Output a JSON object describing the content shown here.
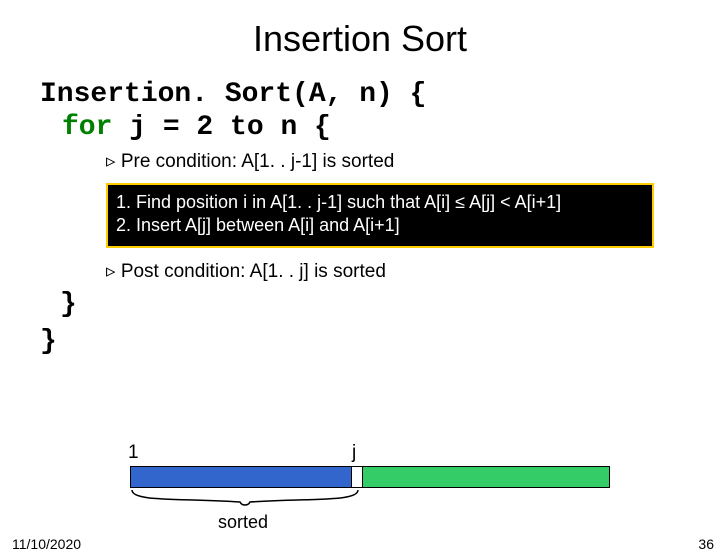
{
  "title": "Insertion Sort",
  "code": {
    "line1a": "Insertion. Sort(A, n) {",
    "line2_kw": "for",
    "line2_rest": " j = 2 to n {",
    "brace_inner": "}",
    "brace_outer": "}"
  },
  "pre": "▹ Pre condition: A[1. . j-1] is sorted",
  "steps": {
    "s1": "1. Find position i in A[1. . j-1] such that A[i] ≤ A[j] < A[i+1]",
    "s2": "2. Insert A[j] between A[i] and A[i+1]"
  },
  "post": "▹ Post condition: A[1. . j] is sorted",
  "diagram": {
    "label_start": "1",
    "label_j": "j",
    "sorted": "sorted"
  },
  "footer": {
    "date": "11/10/2020",
    "page": "36"
  }
}
